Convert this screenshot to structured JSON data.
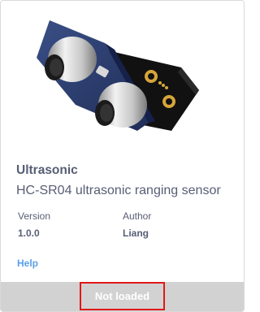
{
  "extension": {
    "name": "Ultrasonic",
    "description": "HC-SR04 ultrasonic ranging sensor",
    "image_icon": "ultrasonic-sensor-image"
  },
  "meta": {
    "version_label": "Version",
    "version_value": "1.0.0",
    "author_label": "Author",
    "author_value": "Liang"
  },
  "help_label": "Help",
  "status": {
    "label": "Not loaded"
  },
  "colors": {
    "text": "#575e75",
    "link": "#5aa0e8",
    "status_bar": "#d2d2d2",
    "highlight_border": "#e01818"
  }
}
